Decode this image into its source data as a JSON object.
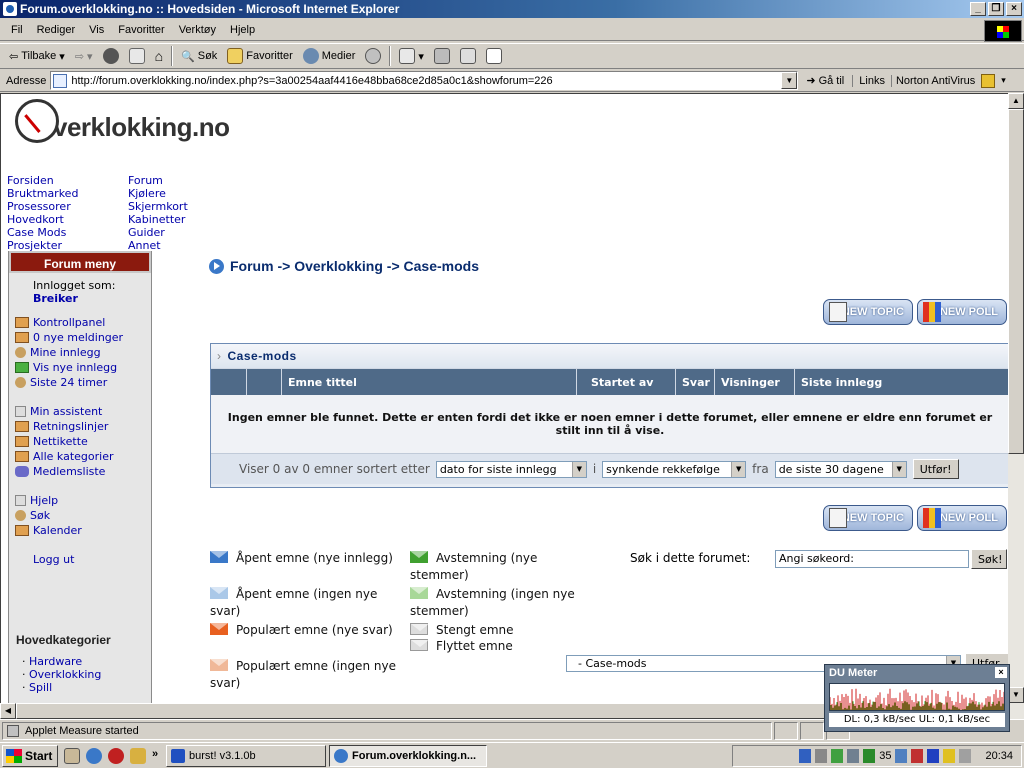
{
  "window": {
    "title": "Forum.overklokking.no :: Hovedsiden - Microsoft Internet Explorer",
    "controls": [
      "_",
      "❐",
      "×"
    ]
  },
  "menu": [
    "Fil",
    "Rediger",
    "Vis",
    "Favoritter",
    "Verktøy",
    "Hjelp"
  ],
  "toolbar": {
    "back": "Tilbake",
    "search": "Søk",
    "favorites": "Favoritter",
    "media": "Medier"
  },
  "address": {
    "label": "Adresse",
    "url": "http://forum.overklokking.no/index.php?s=3a00254aaf4416e48bba68ce2d85a0c1&showforum=226",
    "go": "Gå til",
    "links": "Links",
    "norton": "Norton AntiVirus"
  },
  "site": {
    "logo": "verklokking.no",
    "nav_left": [
      "Forsiden",
      "Bruktmarked",
      "Prosessorer",
      "Hovedkort",
      "Case Mods",
      "Prosjekter"
    ],
    "nav_right": [
      "Forum",
      "Kjølere",
      "Skjermkort",
      "Kabinetter",
      "Guider",
      "Annet"
    ]
  },
  "sidebar": {
    "title": "Forum meny",
    "logged_in_as": "Innlogget som:",
    "username": "Breiker",
    "group1": [
      "Kontrollpanel",
      "0 nye meldinger",
      "Mine innlegg",
      "Vis nye innlegg",
      "Siste 24 timer"
    ],
    "group2": [
      "Min assistent",
      "Retningslinjer",
      "Nettikette",
      "Alle kategorier",
      "Medlemsliste"
    ],
    "group3": [
      "Hjelp",
      "Søk",
      "Kalender"
    ],
    "logout": "Logg ut",
    "categories_title": "Hovedkategorier",
    "categories": [
      "Hardware",
      "Overklokking",
      "Spill"
    ]
  },
  "breadcrumb": {
    "part1": "Forum",
    "sep": " -> ",
    "part2": "Overklokking",
    "part3": "Case-mods"
  },
  "buttons": {
    "new_topic": "NEW TOPIC",
    "new_poll": "NEW POLL"
  },
  "forum": {
    "name": "Case-mods",
    "columns": [
      "",
      "",
      "Emne tittel",
      "Startet av",
      "Svar",
      "Visninger",
      "Siste innlegg"
    ],
    "empty_message": "Ingen emner ble funnet. Dette er enten fordi det ikke er noen emner i dette forumet, eller emnene er eldre enn forumet er stilt inn til å vise.",
    "footer_text": "Viser 0 av 0 emner sortert etter",
    "sort_by": "dato for siste innlegg",
    "in_label": "i",
    "order": "synkende rekkefølge",
    "from_label": "fra",
    "range": "de siste 30 dagene",
    "submit": "Utfør!"
  },
  "legend": {
    "open_new": "Åpent emne (nye innlegg)",
    "open_none": "Åpent emne (ingen nye svar)",
    "popular_new": "Populært emne (nye svar)",
    "popular_none": "Populært emne (ingen nye svar)",
    "poll_new": "Avstemning (nye stemmer)",
    "poll_none": "Avstemning (ingen nye stemmer)",
    "locked": "Stengt emne",
    "moved": "Flyttet emne"
  },
  "search": {
    "label": "Søk i dette forumet:",
    "placeholder": "Angi søkeord:",
    "button": "Søk!"
  },
  "jump": {
    "selected": "- Case-mods",
    "button": "Utfør"
  },
  "du_meter": {
    "title": "DU Meter",
    "reading": "DL: 0,3 kB/sec  UL: 0,1 kB/sec"
  },
  "status": {
    "text": "Applet Measure started"
  },
  "taskbar": {
    "start": "Start",
    "tasks": [
      "burst! v3.1.0b",
      "Forum.overklokking.n..."
    ],
    "tray_number": "35",
    "clock": "20:34"
  },
  "colors": {
    "sidebar_header": "#8b1a0e",
    "table_header": "#4f6a88",
    "link": "#0000aa",
    "breadcrumb": "#0a2c6e"
  }
}
